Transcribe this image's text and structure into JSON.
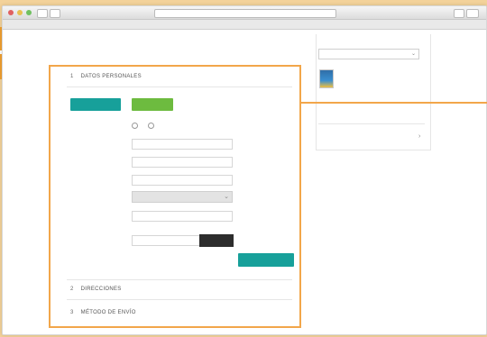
{
  "browser": {
    "url": "",
    "tab_title": "",
    "buttons": [
      "",
      "",
      "",
      ""
    ]
  },
  "checkout": {
    "sections": [
      {
        "number": "1",
        "title": "DATOS PERSONALES"
      },
      {
        "number": "2",
        "title": "DIRECCIONES"
      },
      {
        "number": "3",
        "title": "MÉTODO DE ENVÍO"
      }
    ],
    "order_as_guest_label": "",
    "login_label": "",
    "fields": {
      "social_title": "",
      "radio_one": "",
      "radio_two": "",
      "first_name": "",
      "last_name": "",
      "email": "",
      "country": "",
      "birthdate": "",
      "password": ""
    },
    "show_password_label": "",
    "continue_label": ""
  },
  "sidebar": {
    "heading": "",
    "select_value": "",
    "product_name": "",
    "product_price": "",
    "subtotal_label": "",
    "promo_link": "",
    "summary_label": ""
  },
  "colors": {
    "highlight": "#f2a64a",
    "teal": "#17a09a",
    "green": "#6dbb3f",
    "dark": "#2d2d2d"
  }
}
